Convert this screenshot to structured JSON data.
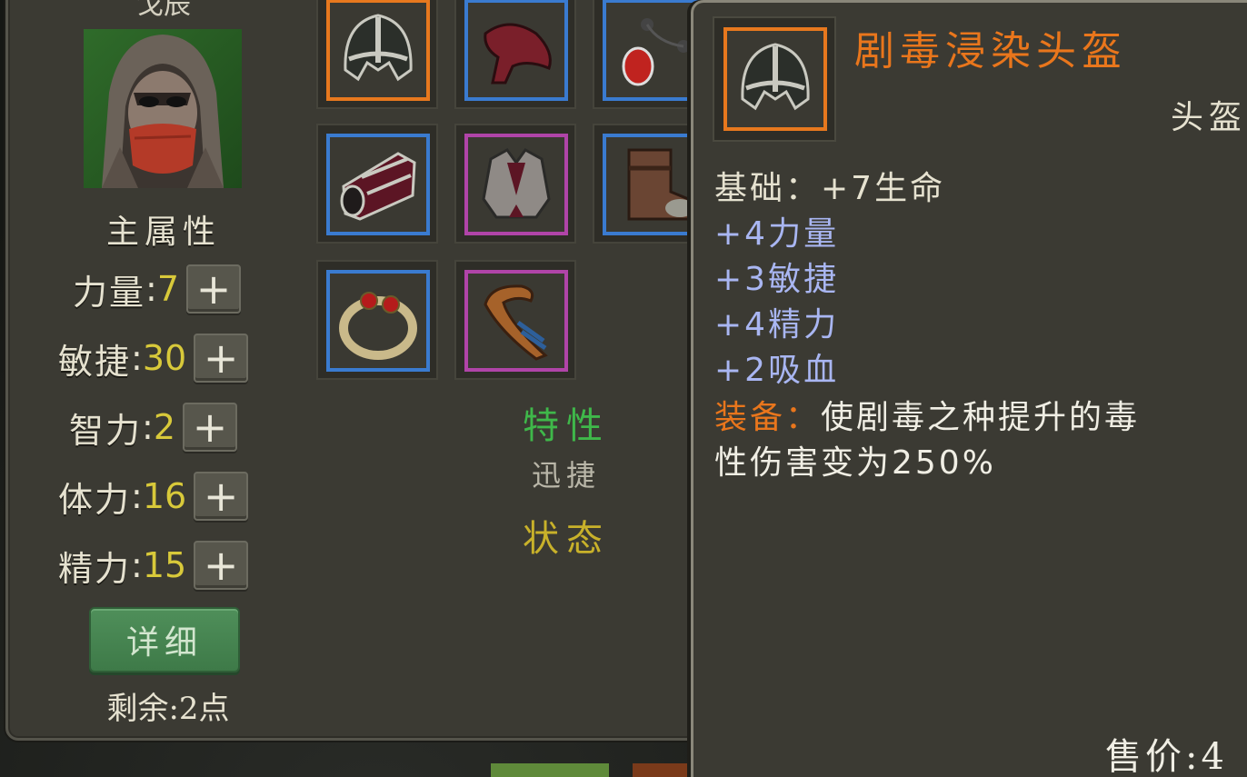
{
  "character": {
    "name": "戈辰",
    "attr_title": "主属性",
    "stats": [
      {
        "label": "力量",
        "value": "7"
      },
      {
        "label": "敏捷",
        "value": "30"
      },
      {
        "label": "智力",
        "value": "2"
      },
      {
        "label": "体力",
        "value": "16"
      },
      {
        "label": "精力",
        "value": "15"
      }
    ],
    "plus_label": "+",
    "colon": ":",
    "detail_button": "详细",
    "remaining_points": "剩余:2点"
  },
  "equipment": {
    "slots": [
      {
        "item": "helmet-icon",
        "frame_color": "#e7781e"
      },
      {
        "item": "shoulder-icon",
        "frame_color": "#3a7bd0"
      },
      {
        "item": "amulet-icon",
        "frame_color": "#3a7bd0"
      },
      {
        "item": "bracer-icon",
        "frame_color": "#3a7bd0"
      },
      {
        "item": "armor-icon",
        "frame_color": "#b044a8"
      },
      {
        "item": "boots-icon",
        "frame_color": "#3a7bd0"
      },
      {
        "item": "ring-icon",
        "frame_color": "#3a7bd0"
      },
      {
        "item": "horn-icon",
        "frame_color": "#b044a8"
      }
    ]
  },
  "traits": {
    "title": "特性",
    "value": "迅捷",
    "state_title": "状态"
  },
  "tooltip": {
    "name": "剧毒浸染头盔",
    "type": "头盔",
    "base": "基础：+7生命",
    "bonuses": [
      "+4力量",
      "+3敏捷",
      "+4精力",
      "+2吸血"
    ],
    "equip_label": "装备：",
    "equip_text_1": "使剧毒之种提升的毒",
    "equip_text_2": "性伤害变为250%",
    "price": "售价:4"
  },
  "colors": {
    "panel": "#3b3a33",
    "orange": "#e7781e",
    "blue_frame": "#3a7bd0",
    "purple_frame": "#b044a8",
    "stat_value": "#d8c93a",
    "bonus_text": "#a9b6f2",
    "trait_green": "#3fb84a",
    "state_yellow": "#c8b12a"
  }
}
